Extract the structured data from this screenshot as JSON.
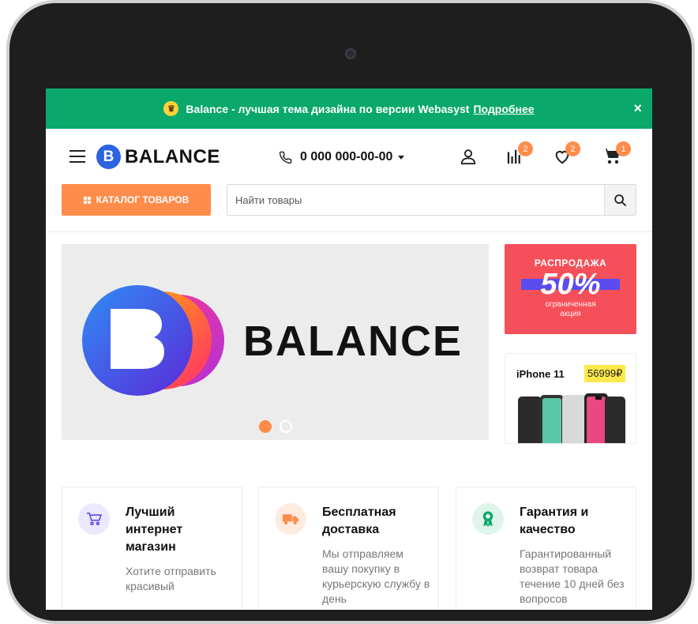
{
  "promo": {
    "text": "Balance - лучшая тема дизайна по версии Webasyst",
    "link": "Подробнее",
    "close_label": "×"
  },
  "header": {
    "logo_letter": "B",
    "logo_text": "BALANCE",
    "phone": "0 000 000-00-00",
    "compare_count": "2",
    "favorites_count": "2",
    "cart_count": "1"
  },
  "search": {
    "catalog_label": "КАТАЛОГ ТОВАРОВ",
    "placeholder": "Найти товары"
  },
  "hero": {
    "logo_letter": "B",
    "title": "BALANCE",
    "slides_total": 2,
    "active_slide": 1
  },
  "sale_banner": {
    "title": "РАСПРОДАЖА",
    "percent": "50%",
    "subtitle_line1": "ограниченная",
    "subtitle_line2": "акция"
  },
  "product_banner": {
    "name": "iPhone 11",
    "price": "56999₽"
  },
  "features": [
    {
      "title": "Лучший интернет магазин",
      "text": "Хотите отправить красивый",
      "icon": "cart-icon",
      "color": "#5b4cf0"
    },
    {
      "title": "Бесплатная доставка",
      "text": "Мы отправляем вашу покупку в курьерскую службу в день",
      "icon": "truck-icon",
      "color": "#ff8c4b"
    },
    {
      "title": "Гарантия и качество",
      "text": "Гарантированный возврат товара течение 10 дней без вопросов",
      "icon": "award-icon",
      "color": "#0aa86a"
    }
  ],
  "colors": {
    "promo_bg": "#0aa86a",
    "accent": "#ff8c4b",
    "sale_bg": "#f5505a"
  }
}
